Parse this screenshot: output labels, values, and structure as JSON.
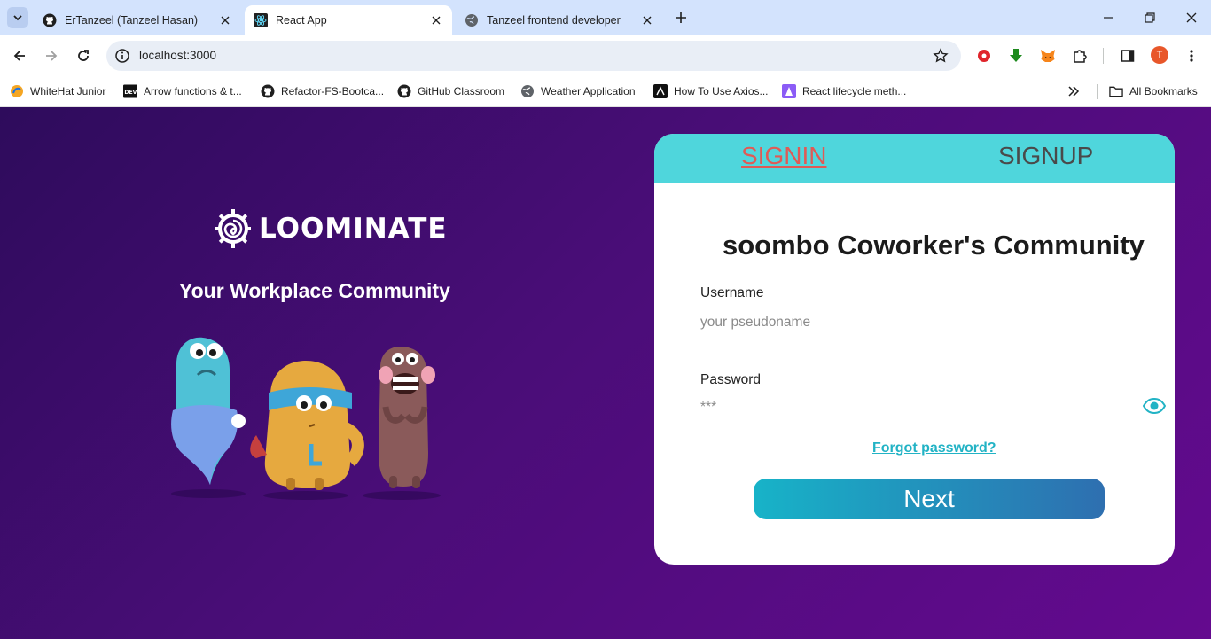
{
  "browser": {
    "tabs": [
      {
        "title": "ErTanzeel (Tanzeel Hasan)",
        "favicon": "github-icon",
        "active": false
      },
      {
        "title": "React App",
        "favicon": "react-icon",
        "active": true
      },
      {
        "title": "Tanzeel frontend developer",
        "favicon": "globe-icon",
        "active": false
      }
    ],
    "url": "localhost:3000",
    "profile_initial": "T",
    "profile_color": "#e8572a",
    "bookmarks": [
      {
        "label": "WhiteHat Junior",
        "icon": "whitehat-icon"
      },
      {
        "label": "Arrow functions & t...",
        "icon": "dev-icon"
      },
      {
        "label": "Refactor-FS-Bootca...",
        "icon": "github-icon"
      },
      {
        "label": "GitHub Classroom",
        "icon": "github-icon"
      },
      {
        "label": "Weather Application",
        "icon": "globe-icon"
      },
      {
        "label": "How To Use Axios...",
        "icon": "digitalocean-icon"
      },
      {
        "label": "React lifecycle meth...",
        "icon": "bookmark-purple-icon"
      }
    ],
    "all_bookmarks_label": "All Bookmarks"
  },
  "hero": {
    "brand": "LOOMINATE",
    "tagline": "Your Workplace Community"
  },
  "auth": {
    "tab_signin": "SIGNIN",
    "tab_signup": "SIGNUP",
    "title": "soombo Coworker's Community",
    "username_label": "Username",
    "username_placeholder": "your pseudoname",
    "password_label": "Password",
    "password_placeholder": "***",
    "forgot_link": "Forgot password?",
    "next_button": "Next"
  },
  "colors": {
    "page_bg_start": "#2e0c5c",
    "page_bg_end": "#640a8f",
    "tab_strip": "#4fd6dc",
    "active_tab_text": "#e05a55",
    "accent": "#22b3c5"
  }
}
